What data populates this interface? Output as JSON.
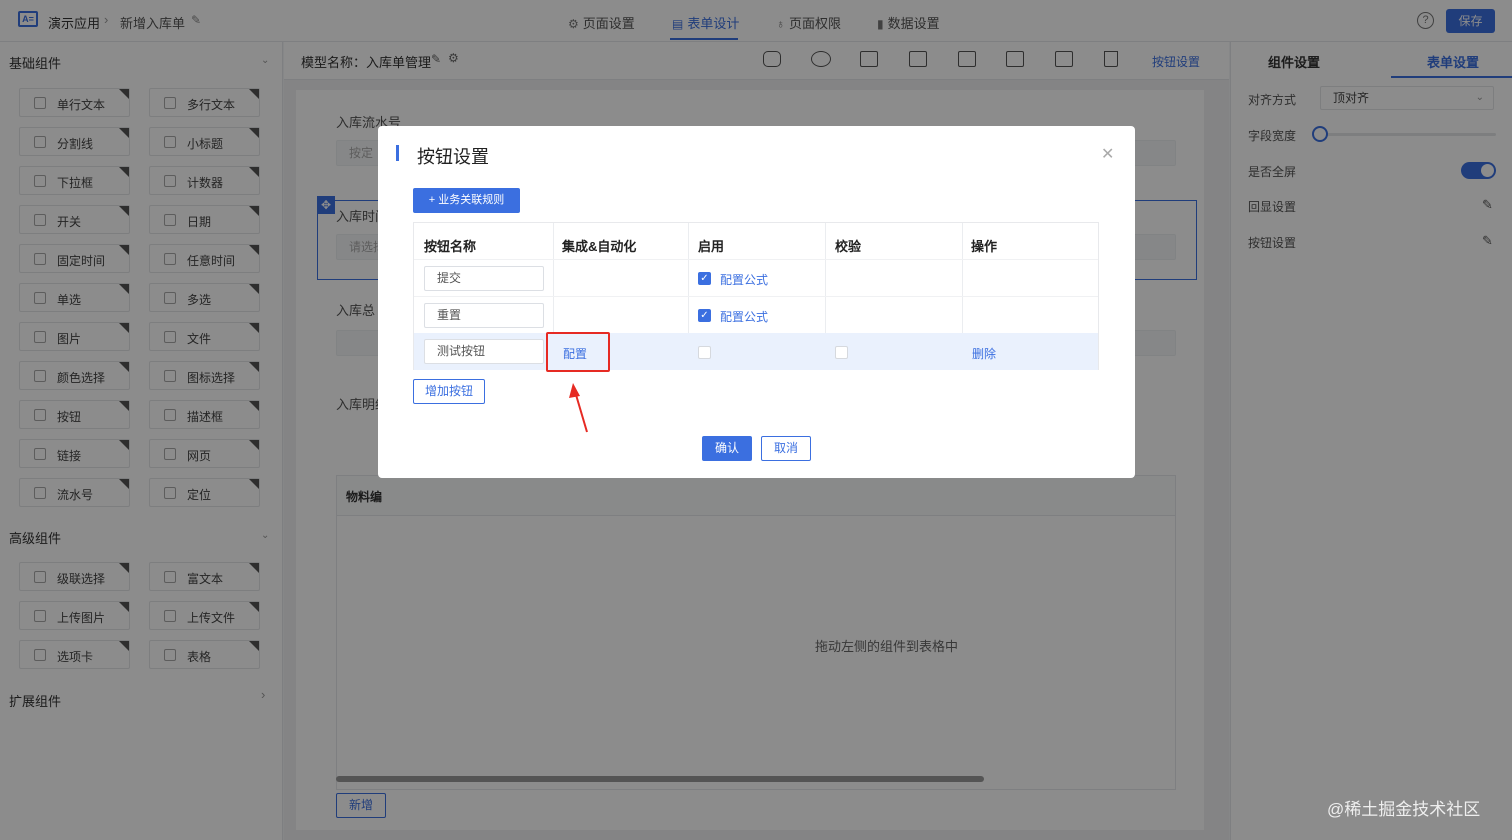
{
  "breadcrumb": {
    "app": "演示应用",
    "page": "新增入库单"
  },
  "top_tabs": [
    {
      "label": "页面设置",
      "icon": "gear-icon"
    },
    {
      "label": "表单设计",
      "icon": "document-icon"
    },
    {
      "label": "页面权限",
      "icon": "lock-icon"
    },
    {
      "label": "数据设置",
      "icon": "bar-chart-icon"
    }
  ],
  "top_tabs_active": "表单设计",
  "help_icon": "?",
  "save_label": "保存",
  "left": {
    "basic_title": "基础组件",
    "advanced_title": "高级组件",
    "extended_title": "扩展组件",
    "basic_items": [
      "单行文本",
      "多行文本",
      "分割线",
      "小标题",
      "下拉框",
      "计数器",
      "开关",
      "日期",
      "固定时间",
      "任意时间",
      "单选",
      "多选",
      "图片",
      "文件",
      "颜色选择",
      "图标选择",
      "按钮",
      "描述框",
      "链接",
      "网页",
      "流水号",
      "定位"
    ],
    "advanced_items": [
      "级联选择",
      "富文本",
      "上传图片",
      "上传文件",
      "选项卡",
      "表格"
    ]
  },
  "center": {
    "model_name": "模型名称：入库单管理",
    "button_settings_link": "按钮设置",
    "fields": {
      "serial_label": "入库流水号",
      "serial_placeholder": "按定",
      "time_label": "入库时间",
      "time_placeholder": "请选择",
      "total_label": "入库总",
      "detail_label": "入库明细"
    },
    "detail_table_head": "物料编",
    "drag_hint": "拖动左侧的组件到表格中",
    "add_new": "新增"
  },
  "right": {
    "tab_component": "组件设置",
    "tab_form": "表单设置",
    "align_label": "对齐方式",
    "align_value": "顶对齐",
    "field_width_label": "字段宽度",
    "field_width_value": 0,
    "fullscreen_label": "是否全屏",
    "fullscreen_on": true,
    "echo_label": "回显设置",
    "button_settings_label": "按钮设置"
  },
  "dialog": {
    "title": "按钮设置",
    "rule_button": "+ 业务关联规则",
    "headers": [
      "按钮名称",
      "集成&自动化",
      "启用",
      "校验",
      "操作"
    ],
    "rows": [
      {
        "name": "提交",
        "integration": "",
        "enabled": true,
        "enabled_link": "配置公式",
        "validate": false,
        "action": ""
      },
      {
        "name": "重置",
        "integration": "",
        "enabled": true,
        "enabled_link": "配置公式",
        "validate": false,
        "action": ""
      },
      {
        "name": "测试按钮",
        "integration": "配置",
        "enabled": false,
        "enabled_link": "",
        "validate": false,
        "action": "删除"
      }
    ],
    "add_button": "增加按钮",
    "ok": "确认",
    "cancel": "取消"
  },
  "annotation_color": "#e62a23",
  "accent_color": "#3b6fe0",
  "watermark": "@稀土掘金技术社区"
}
